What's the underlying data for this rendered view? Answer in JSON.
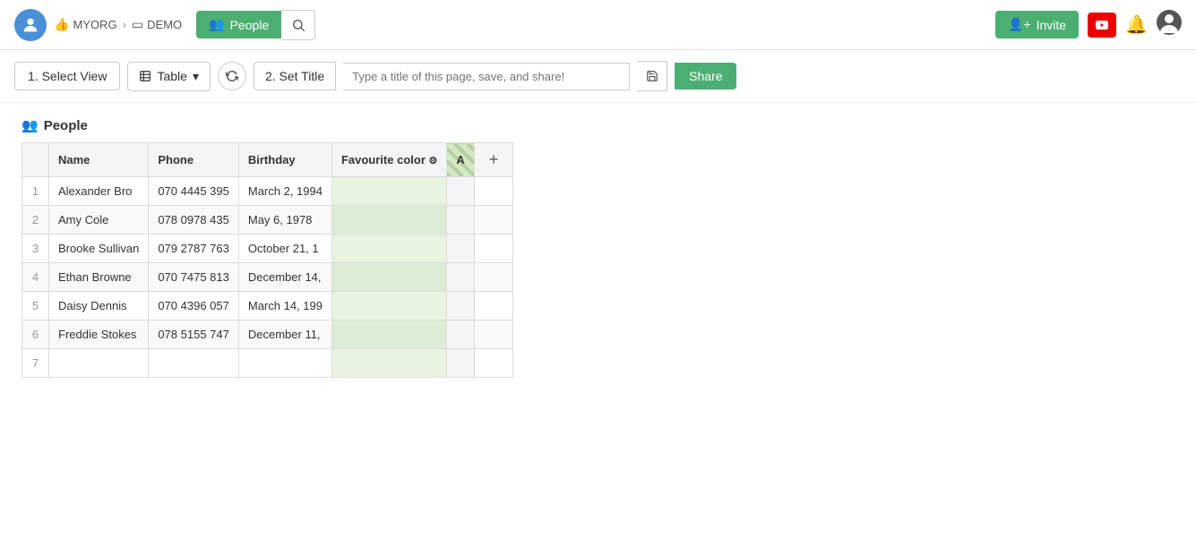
{
  "topnav": {
    "org_label": "MYORG",
    "demo_label": "DEMO",
    "people_btn_label": "People",
    "invite_btn_label": "Invite",
    "search_placeholder": "Search"
  },
  "toolbar": {
    "select_view_label": "1. Select View",
    "table_label": "Table",
    "set_title_label": "2. Set Title",
    "title_placeholder": "Type a title of this page, save, and share!",
    "share_label": "Share"
  },
  "section": {
    "title": "People"
  },
  "table": {
    "columns": [
      {
        "key": "name",
        "label": "Name"
      },
      {
        "key": "phone",
        "label": "Phone"
      },
      {
        "key": "birthday",
        "label": "Birthday"
      },
      {
        "key": "favourite_color",
        "label": "Favourite color"
      },
      {
        "key": "a",
        "label": "A"
      }
    ],
    "rows": [
      {
        "num": 1,
        "name": "Alexander Bro",
        "phone": "070 4445 395",
        "birthday": "March 2, 1994",
        "favourite_color": "",
        "a": ""
      },
      {
        "num": 2,
        "name": "Amy Cole",
        "phone": "078 0978 435",
        "birthday": "May 6, 1978",
        "favourite_color": "",
        "a": ""
      },
      {
        "num": 3,
        "name": "Brooke Sullivan",
        "phone": "079 2787 763",
        "birthday": "October 21, 1",
        "favourite_color": "",
        "a": ""
      },
      {
        "num": 4,
        "name": "Ethan Browne",
        "phone": "070 7475 813",
        "birthday": "December 14,",
        "favourite_color": "",
        "a": ""
      },
      {
        "num": 5,
        "name": "Daisy Dennis",
        "phone": "070 4396 057",
        "birthday": "March 14, 199",
        "favourite_color": "",
        "a": ""
      },
      {
        "num": 6,
        "name": "Freddie Stokes",
        "phone": "078 5155 747",
        "birthday": "December 11,",
        "favourite_color": "",
        "a": ""
      },
      {
        "num": 7,
        "name": "",
        "phone": "",
        "birthday": "",
        "favourite_color": "",
        "a": ""
      }
    ]
  }
}
